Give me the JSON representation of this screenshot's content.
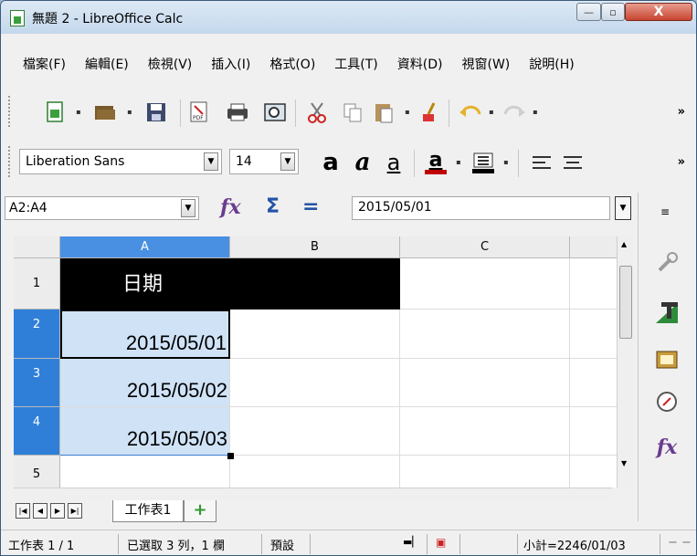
{
  "window": {
    "title": "無題 2 - LibreOffice Calc",
    "buttons": {
      "minimize": "—",
      "maximize": "▫",
      "close": "X"
    }
  },
  "menubar": [
    "檔案(F)",
    "編輯(E)",
    "檢視(V)",
    "插入(I)",
    "格式(O)",
    "工具(T)",
    "資料(D)",
    "視窗(W)",
    "說明(H)"
  ],
  "toolbar_standard": {
    "icons": [
      "new-document-icon",
      "open-folder-icon",
      "save-icon",
      "export-pdf-icon",
      "print-icon",
      "print-preview-icon",
      "cut-icon",
      "copy-icon",
      "paste-icon",
      "clone-formatting-icon",
      "undo-icon",
      "redo-icon"
    ],
    "pdf_label": "PDF",
    "more": "»"
  },
  "toolbar_formatting": {
    "font_name": "Liberation Sans",
    "font_size": "14",
    "bold": "a",
    "italic": "a",
    "underline": "a",
    "font_color_letter": "a",
    "more": "»"
  },
  "formula_bar": {
    "name_box": "A2:A4",
    "function_wizard": "fx",
    "sum": "Σ",
    "function": "=",
    "input": "2015/05/01"
  },
  "grid": {
    "columns": [
      "A",
      "B",
      "C"
    ],
    "rows": [
      "1",
      "2",
      "3",
      "4",
      "5"
    ],
    "cells": {
      "A1": "日期",
      "A2": "2015/05/01",
      "A3": "2015/05/02",
      "A4": "2015/05/03"
    }
  },
  "sheet_tabs": {
    "nav_icons": [
      "first-sheet-icon",
      "prev-sheet-icon",
      "next-sheet-icon",
      "last-sheet-icon"
    ],
    "sheets": [
      "工作表1"
    ],
    "add": "+"
  },
  "statusbar": {
    "sheet": "工作表 1 / 1",
    "selection": "已選取 3 列，1 欄",
    "style": "預設",
    "sum": "小計=2246/01/03"
  },
  "sidebar": {
    "icons": [
      "properties-icon",
      "styles-icon",
      "gallery-icon",
      "navigator-icon",
      "functions-icon"
    ]
  },
  "colors": {
    "selection_fill": "#cfe2f6",
    "header_selected": "#2f7fd9",
    "header_fill": "#000000"
  }
}
